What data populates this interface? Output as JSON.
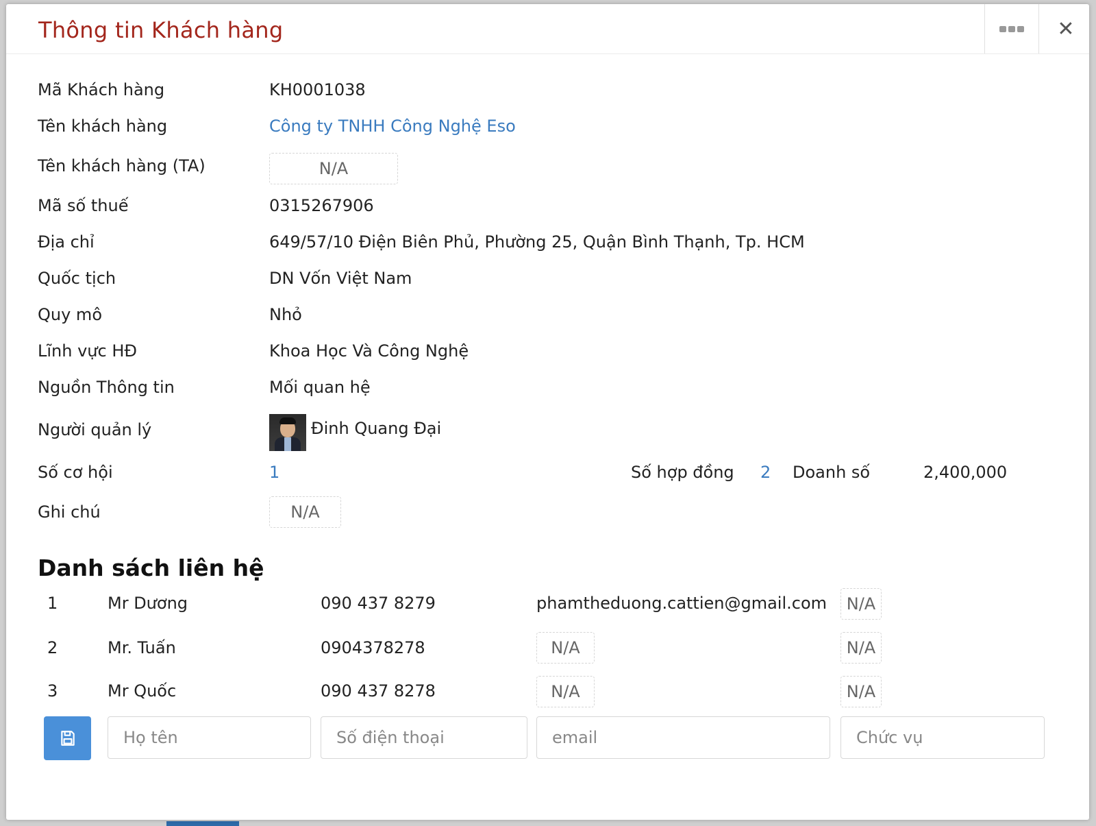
{
  "modal": {
    "title": "Thông tin Khách hàng",
    "more_icon": "more-dots-icon",
    "close_icon": "close-icon",
    "close_glyph": "✕"
  },
  "info": {
    "ma_kh": {
      "label": "Mã Khách hàng",
      "value": "KH0001038"
    },
    "ten_kh": {
      "label": "Tên khách hàng",
      "value": "Công ty TNHH Công Nghệ Eso"
    },
    "ten_kh_ta": {
      "label": "Tên khách hàng (TA)",
      "value": "N/A"
    },
    "mst": {
      "label": "Mã số thuế",
      "value": "0315267906"
    },
    "dia_chi": {
      "label": "Địa chỉ",
      "value": "649/57/10 Điện Biên Phủ, Phường 25, Quận Bình Thạnh, Tp. HCM"
    },
    "quoc_tich": {
      "label": "Quốc tịch",
      "value": "DN Vốn Việt Nam"
    },
    "quy_mo": {
      "label": "Quy mô",
      "value": "Nhỏ"
    },
    "linh_vuc": {
      "label": "Lĩnh vực HĐ",
      "value": "Khoa Học Và Công Nghệ"
    },
    "nguon": {
      "label": "Nguồn Thông tin",
      "value": "Mối quan hệ"
    },
    "quan_ly": {
      "label": "Người quản lý",
      "value": "Đinh Quang Đại"
    },
    "so_co_hoi": {
      "label": "Số cơ hội",
      "value": "1"
    },
    "so_hop_dong": {
      "label": "Số hợp đồng",
      "value": "2"
    },
    "doanh_so": {
      "label": "Doanh số",
      "value": "2,400,000"
    },
    "ghi_chu": {
      "label": "Ghi chú",
      "value": "N/A"
    }
  },
  "contacts": {
    "title": "Danh sách liên hệ",
    "rows": [
      {
        "index": "1",
        "name": "Mr Dương",
        "phone": "090 437 8279",
        "email": "phamtheduong.cattien@gmail.com",
        "position": "N/A"
      },
      {
        "index": "2",
        "name": "Mr. Tuấn",
        "phone": "0904378278",
        "email": "N/A",
        "position": "N/A"
      },
      {
        "index": "3",
        "name": "Mr Quốc",
        "phone": "090 437 8278",
        "email": "N/A",
        "position": "N/A"
      }
    ],
    "form": {
      "save_icon": "save-icon",
      "name_placeholder": "Họ tên",
      "phone_placeholder": "Số điện thoại",
      "email_placeholder": "email",
      "position_placeholder": "Chức vụ"
    }
  },
  "colors": {
    "title": "#a3261c",
    "link": "#3a7bbf",
    "save_button": "#4a90d9"
  }
}
